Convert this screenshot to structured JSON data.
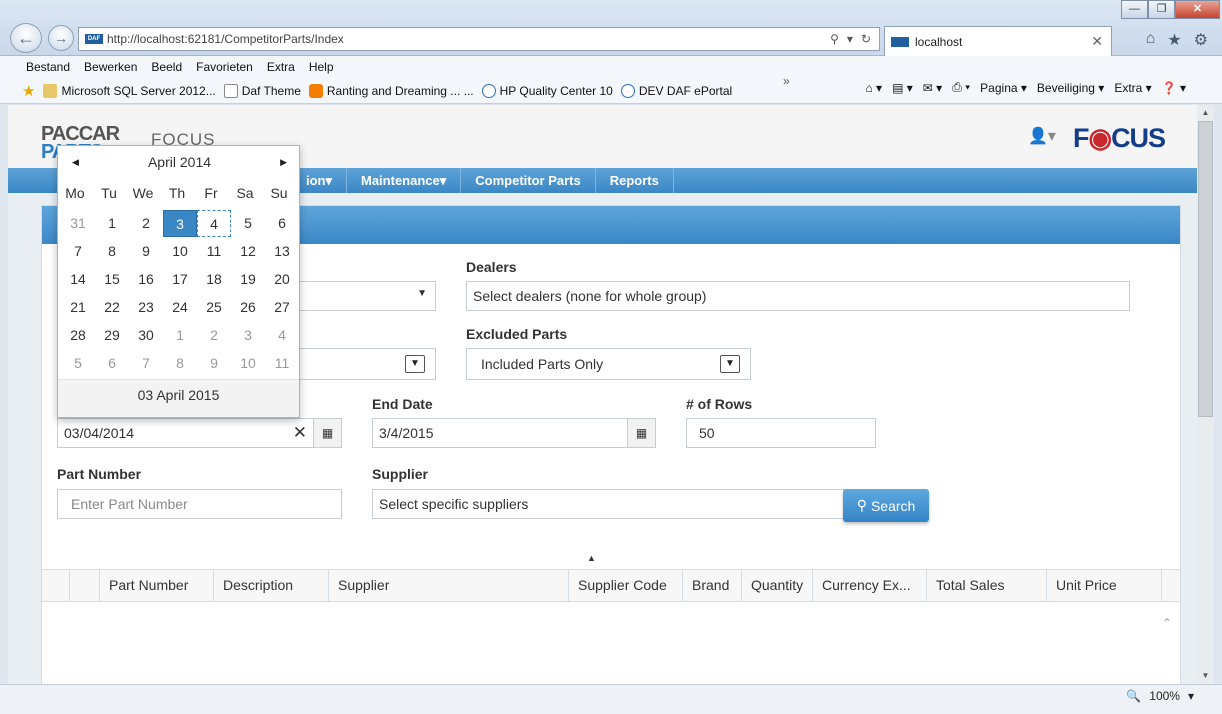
{
  "browser": {
    "url": "http://localhost:62181/CompetitorParts/Index",
    "url_host": "localhost",
    "tab_title": "localhost",
    "menu": [
      "Bestand",
      "Bewerken",
      "Beeld",
      "Favorieten",
      "Extra",
      "Help"
    ],
    "favorites": [
      "Microsoft SQL Server 2012...",
      "Daf Theme",
      "Ranting and Dreaming ... ...",
      "HP Quality Center 10",
      "DEV DAF ePortal"
    ],
    "commands": [
      "Pagina",
      "Beveiliging",
      "Extra"
    ],
    "zoom": "100%"
  },
  "header": {
    "logo_top": "PACCAR",
    "logo_bottom": "PARTS",
    "app_name": "FOCUS",
    "brand": "FOCUS"
  },
  "nav": {
    "items": [
      "ion",
      "Maintenance",
      "Competitor Parts",
      "Reports"
    ]
  },
  "form": {
    "dealers_label": "Dealers",
    "dealers_value": "Select dealers (none for whole group)",
    "excluded_label": "Excluded Parts",
    "excluded_value": "Included Parts Only",
    "start_date_value": "03/04/2014",
    "end_date_label": "End Date",
    "end_date_value": "3/4/2015",
    "rows_label": "# of Rows",
    "rows_value": "50",
    "part_number_label": "Part Number",
    "part_number_placeholder": "Enter Part Number",
    "supplier_label": "Supplier",
    "supplier_value": "Select specific suppliers",
    "search_label": "Search"
  },
  "grid": {
    "columns": [
      "",
      "",
      "Part Number",
      "Description",
      "Supplier",
      "Supplier Code",
      "Brand",
      "Quantity",
      "Currency Ex...",
      "Total Sales",
      "Unit Price"
    ]
  },
  "calendar": {
    "title": "April 2014",
    "weekdays": [
      "Mo",
      "Tu",
      "We",
      "Th",
      "Fr",
      "Sa",
      "Su"
    ],
    "weeks": [
      [
        "31",
        "1",
        "2",
        "3",
        "4",
        "5",
        "6"
      ],
      [
        "7",
        "8",
        "9",
        "10",
        "11",
        "12",
        "13"
      ],
      [
        "14",
        "15",
        "16",
        "17",
        "18",
        "19",
        "20"
      ],
      [
        "21",
        "22",
        "23",
        "24",
        "25",
        "26",
        "27"
      ],
      [
        "28",
        "29",
        "30",
        "1",
        "2",
        "3",
        "4"
      ],
      [
        "5",
        "6",
        "7",
        "8",
        "9",
        "10",
        "11"
      ]
    ],
    "selected_day": "3",
    "today_day": "4",
    "footer": "03 April 2015"
  }
}
